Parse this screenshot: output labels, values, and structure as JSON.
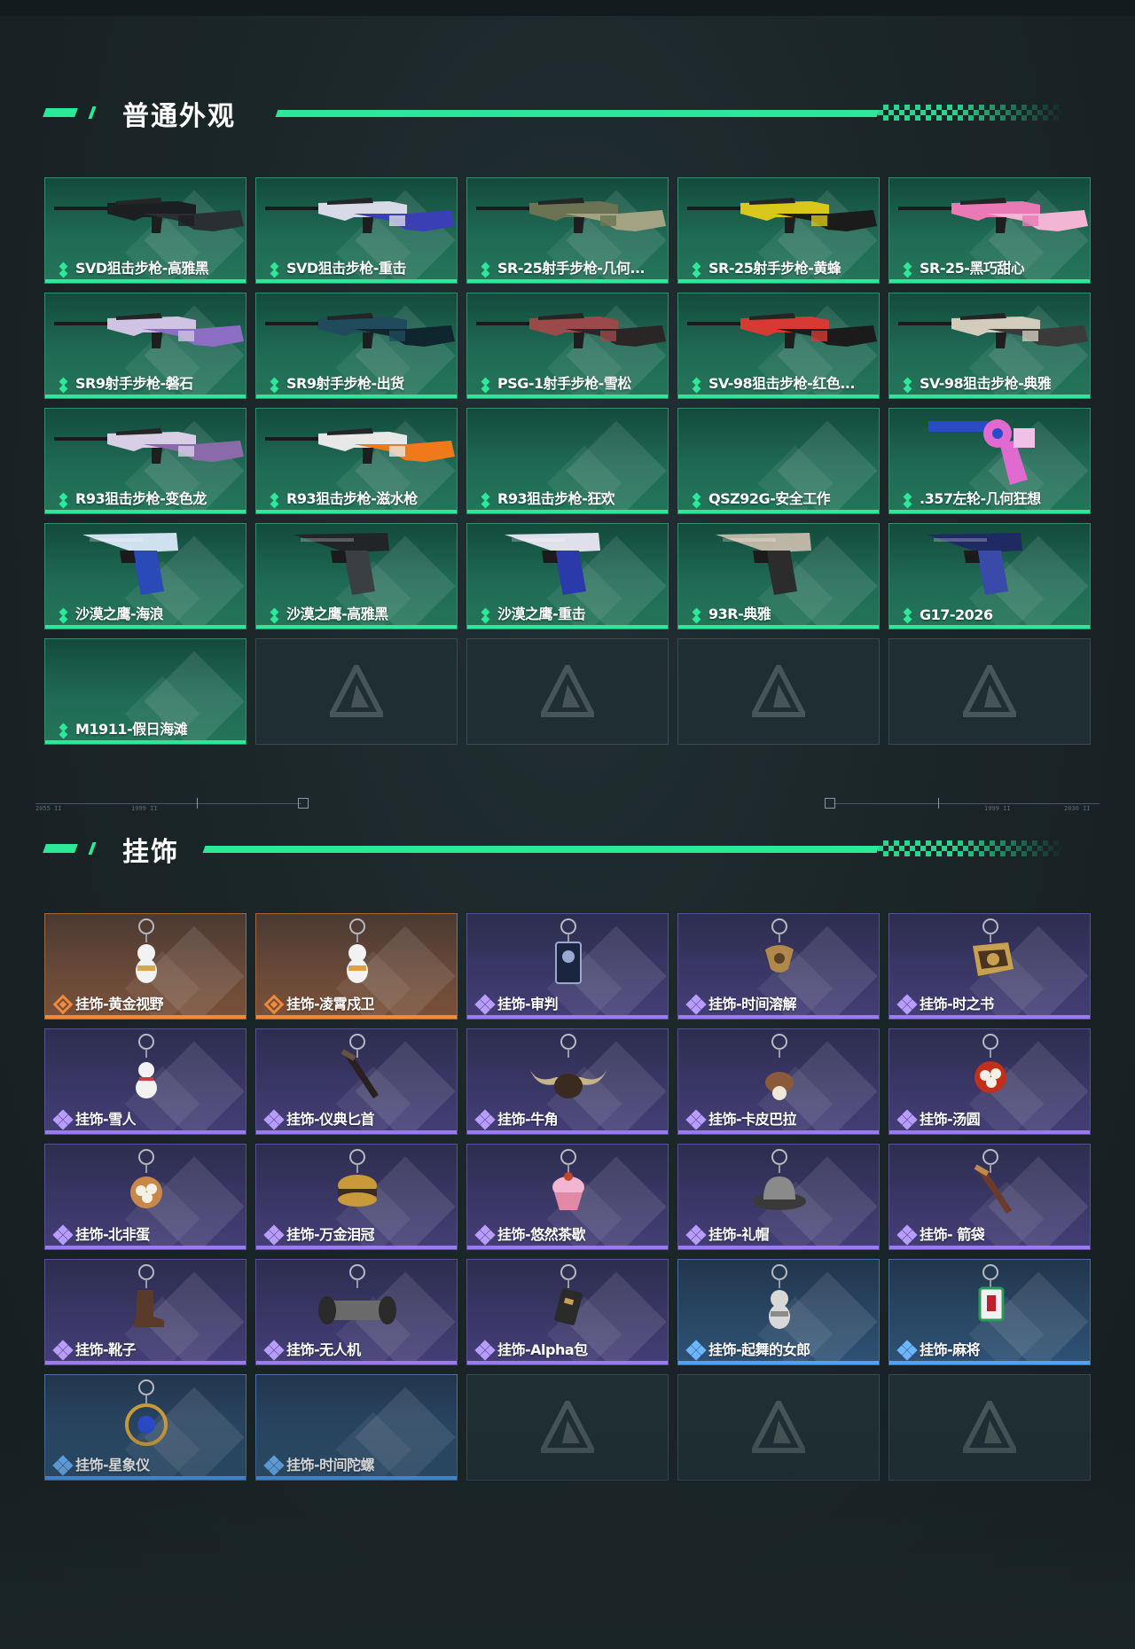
{
  "sections": {
    "skins": {
      "title": "普通外观",
      "items": [
        {
          "label": "SVD狙击步枪-高雅黑",
          "art": "rifle",
          "colors": [
            "#1b1f22",
            "#2a2f33"
          ]
        },
        {
          "label": "SVD狙击步枪-重击",
          "art": "rifle",
          "colors": [
            "#d8dae8",
            "#3a3fb5"
          ]
        },
        {
          "label": "SR-25射手步枪-几何...",
          "art": "rifle",
          "colors": [
            "#6b7352",
            "#a3a383"
          ]
        },
        {
          "label": "SR-25射手步枪-黄蜂",
          "art": "rifle",
          "colors": [
            "#d8c81a",
            "#1b1b1b"
          ]
        },
        {
          "label": "SR-25-黑巧甜心",
          "art": "rifle",
          "colors": [
            "#e97ab5",
            "#f2b6d4"
          ]
        },
        {
          "label": "SR9射手步枪-磐石",
          "art": "rifle",
          "colors": [
            "#cfc4e3",
            "#8c6fc4"
          ]
        },
        {
          "label": "SR9射手步枪-出货",
          "art": "rifle",
          "colors": [
            "#1f4b5c",
            "#10262e"
          ]
        },
        {
          "label": "PSG-1射手步枪-雪松",
          "art": "rifle",
          "colors": [
            "#9a4a48",
            "#2a2626"
          ]
        },
        {
          "label": "SV-98狙击步枪-红色...",
          "art": "rifle",
          "colors": [
            "#d63a32",
            "#1b1b1b"
          ]
        },
        {
          "label": "SV-98狙击步枪-典雅",
          "art": "rifle",
          "colors": [
            "#d2ccbc",
            "#3a3a3a"
          ]
        },
        {
          "label": "R93狙击步枪-变色龙",
          "art": "rifle",
          "colors": [
            "#d8cfe6",
            "#8a6aa8"
          ]
        },
        {
          "label": "R93狙击步枪-滋水枪",
          "art": "rifle",
          "colors": [
            "#e8e8e8",
            "#f07a1a"
          ]
        },
        {
          "label": "R93狙击步枪-狂欢",
          "art": "none",
          "colors": [
            "#247559",
            "#247559"
          ]
        },
        {
          "label": "QSZ92G-安全工作",
          "art": "none",
          "colors": [
            "#247559",
            "#247559"
          ]
        },
        {
          "label": ".357左轮-几何狂想",
          "art": "revolver",
          "colors": [
            "#2a4ac8",
            "#e06ad0"
          ]
        },
        {
          "label": "沙漠之鹰-海浪",
          "art": "pistol",
          "colors": [
            "#cfe0ef",
            "#2a4ab8"
          ]
        },
        {
          "label": "沙漠之鹰-高雅黑",
          "art": "pistol",
          "colors": [
            "#222527",
            "#3a3f44"
          ]
        },
        {
          "label": "沙漠之鹰-重击",
          "art": "pistol",
          "colors": [
            "#dfe0ec",
            "#2a3aa8"
          ]
        },
        {
          "label": "93R-典雅",
          "art": "pistol",
          "colors": [
            "#bdb6a4",
            "#2c2c2c"
          ]
        },
        {
          "label": "G17-2026",
          "art": "pistol",
          "colors": [
            "#1f2a63",
            "#3a4aa8"
          ]
        },
        {
          "label": "M1911-假日海滩",
          "art": "none",
          "colors": [
            "#247559",
            "#247559"
          ]
        }
      ],
      "empty_slots": 4
    },
    "charms": {
      "title": "挂饰",
      "items": [
        {
          "label": "挂饰-黄金视野",
          "rarity": "orange",
          "art": "figure",
          "colors": [
            "#f2f2f2",
            "#d6a84a"
          ]
        },
        {
          "label": "挂饰-凌霄戍卫",
          "rarity": "orange",
          "art": "figure",
          "colors": [
            "#f2f2f2",
            "#e0a040"
          ]
        },
        {
          "label": "挂饰-审判",
          "rarity": "purple",
          "art": "card",
          "colors": [
            "#1b2540",
            "#9ba8d0"
          ]
        },
        {
          "label": "挂饰-时间溶解",
          "rarity": "purple",
          "art": "clock",
          "colors": [
            "#b0884a",
            "#5a4024"
          ]
        },
        {
          "label": "挂饰-时之书",
          "rarity": "purple",
          "art": "book",
          "colors": [
            "#c8a050",
            "#4a3420"
          ]
        },
        {
          "label": "挂饰-雪人",
          "rarity": "purple",
          "art": "snowman",
          "colors": [
            "#f2f2f2",
            "#d03a3a"
          ]
        },
        {
          "label": "挂饰-仪典匕首",
          "rarity": "purple",
          "art": "dagger",
          "colors": [
            "#2a2020",
            "#6a5040"
          ]
        },
        {
          "label": "挂饰-牛角",
          "rarity": "purple",
          "art": "horns",
          "colors": [
            "#c8b48a",
            "#3a2a20"
          ]
        },
        {
          "label": "挂饰-卡皮巴拉",
          "rarity": "purple",
          "art": "capy",
          "colors": [
            "#8a5a3a",
            "#f2e8d8"
          ]
        },
        {
          "label": "挂饰-汤圆",
          "rarity": "purple",
          "art": "bowl",
          "colors": [
            "#c0301a",
            "#f5f0e6"
          ]
        },
        {
          "label": "挂饰-北非蛋",
          "rarity": "purple",
          "art": "bowl",
          "colors": [
            "#c8884a",
            "#f5f0e6"
          ]
        },
        {
          "label": "挂饰-万金泪冠",
          "rarity": "purple",
          "art": "burger",
          "colors": [
            "#c89a3a",
            "#3a2a20"
          ]
        },
        {
          "label": "挂饰-悠然茶歇",
          "rarity": "purple",
          "art": "cupcake",
          "colors": [
            "#f2b6d0",
            "#c0482a"
          ]
        },
        {
          "label": "挂饰-礼帽",
          "rarity": "purple",
          "art": "hat",
          "colors": [
            "#8a8a8a",
            "#3a3a3a"
          ]
        },
        {
          "label": "挂饰- 箭袋",
          "rarity": "purple",
          "art": "dagger",
          "colors": [
            "#6a3a2a",
            "#c08a4a"
          ]
        },
        {
          "label": "挂饰-靴子",
          "rarity": "purple",
          "art": "boot",
          "colors": [
            "#5a3a2a",
            "#2a1a14"
          ]
        },
        {
          "label": "挂饰-无人机",
          "rarity": "purple",
          "art": "drone",
          "colors": [
            "#2a2a2a",
            "#6a6a6a"
          ]
        },
        {
          "label": "挂饰-Alpha包",
          "rarity": "purple",
          "art": "pack",
          "colors": [
            "#2a2a2a",
            "#c8a050"
          ]
        },
        {
          "label": "挂饰-起舞的女郎",
          "rarity": "blue",
          "art": "figure",
          "colors": [
            "#d8d8d8",
            "#8a8a8a"
          ]
        },
        {
          "label": "挂饰-麻将",
          "rarity": "blue",
          "art": "tile",
          "colors": [
            "#f2f2f2",
            "#c0202a"
          ]
        },
        {
          "label": "挂饰-星象仪",
          "rarity": "blue",
          "art": "astro",
          "colors": [
            "#c89a3a",
            "#2a4ac8"
          ]
        },
        {
          "label": "挂饰-时间陀螺",
          "rarity": "blue",
          "art": "none",
          "colors": [
            "#2e5275",
            "#2e5275"
          ]
        }
      ],
      "empty_slots": 3
    }
  },
  "ruler_labels": [
    "2055 II",
    "1999 II",
    "1999 II",
    "2030 II"
  ]
}
